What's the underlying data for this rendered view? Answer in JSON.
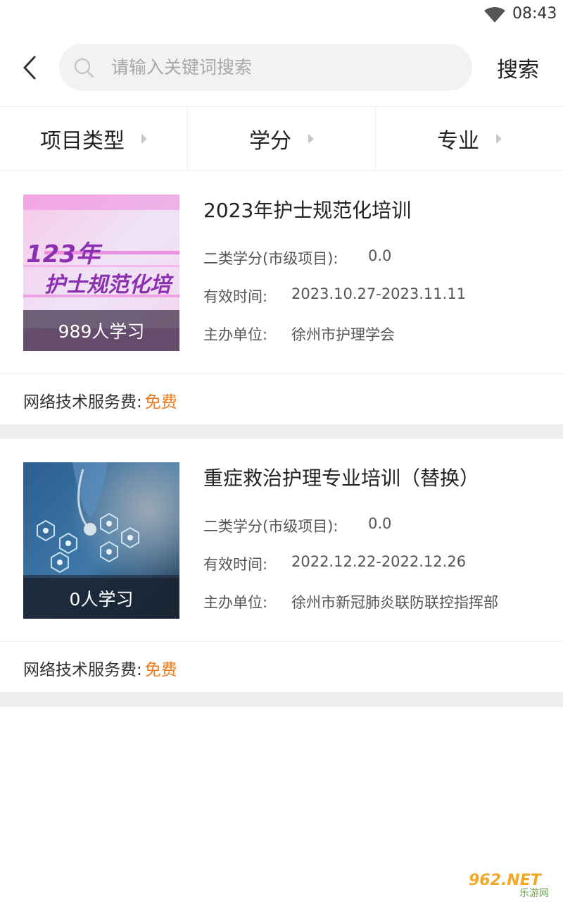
{
  "status_bar": {
    "time": "08:43"
  },
  "search": {
    "placeholder": "请输入关键词搜索",
    "value": "",
    "button_label": "搜索"
  },
  "filters": [
    {
      "label": "项目类型"
    },
    {
      "label": "学分"
    },
    {
      "label": "专业"
    }
  ],
  "courses": [
    {
      "title": "2023年护士规范化培训",
      "thumb_caption": "989人学习",
      "thumb_overlay_text_1": "123年",
      "thumb_overlay_text_2": "护士规范化培",
      "credit_label": "二类学分(市级项目):",
      "credit_value": "0.0",
      "valid_label": "有效时间:",
      "valid_value": "2023.10.27-2023.11.11",
      "host_label": "主办单位:",
      "host_value": "徐州市护理学会",
      "fee_label": "网络技术服务费:",
      "fee_value": "免费"
    },
    {
      "title": "重症救治护理专业培训（替换）",
      "thumb_caption": "0人学习",
      "credit_label": "二类学分(市级项目):",
      "credit_value": "0.0",
      "valid_label": "有效时间:",
      "valid_value": "2022.12.22-2022.12.26",
      "host_label": "主办单位:",
      "host_value": "徐州市新冠肺炎联防联控指挥部",
      "fee_label": "网络技术服务费:",
      "fee_value": "免费"
    }
  ],
  "watermark": {
    "text_top": "962.NET",
    "text_bottom": "乐游网"
  },
  "colors": {
    "accent_fee": "#f07a1b",
    "search_bg": "#f2f2f2",
    "divider": "#eeeeee"
  }
}
